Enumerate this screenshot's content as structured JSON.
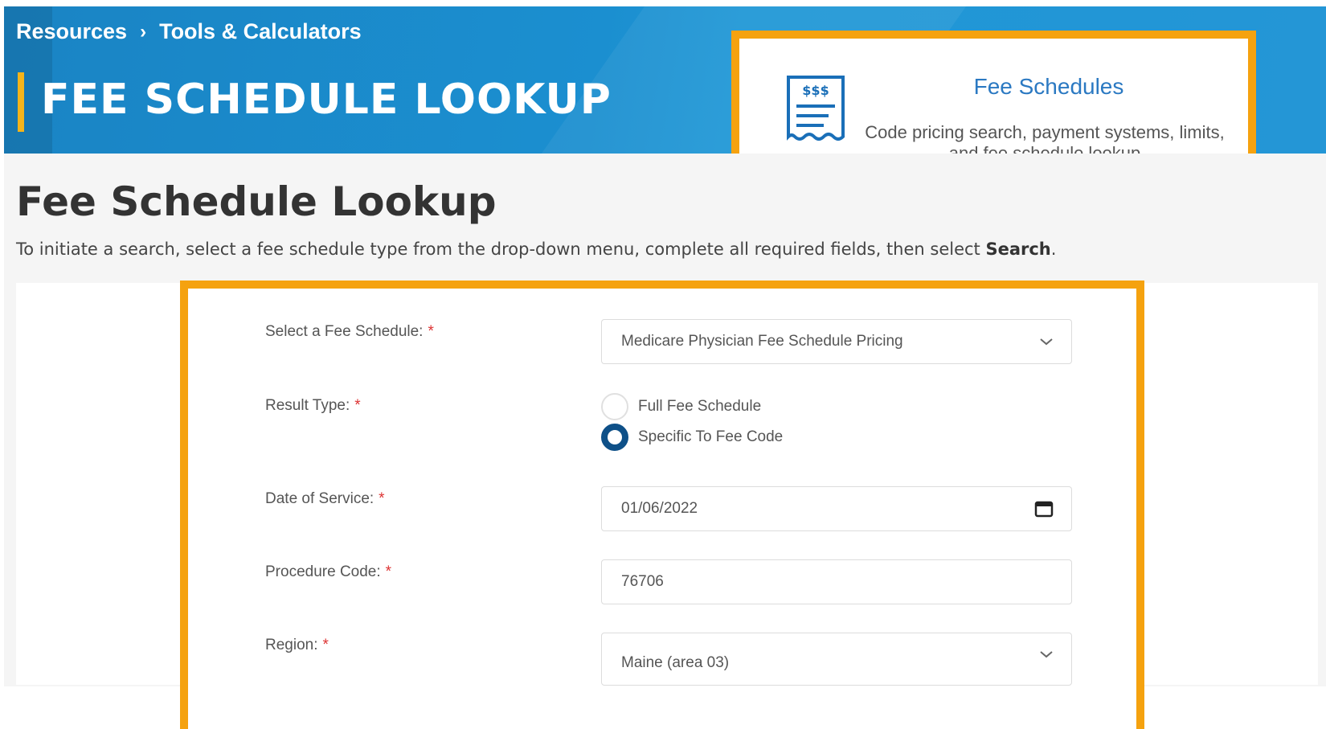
{
  "breadcrumb": {
    "items": [
      "Resources",
      "Tools & Calculators"
    ],
    "separator": "›"
  },
  "banner": {
    "title": "FEE SCHEDULE LOOKUP"
  },
  "card": {
    "title": "Fee Schedules",
    "description": "Code pricing search, payment systems, limits, and fee schedule lookup",
    "icon": "receipt-dollar-icon",
    "icon_text": "$$$"
  },
  "page": {
    "title": "Fee Schedule Lookup",
    "intro_text": "To initiate a search, select a fee schedule type from the drop-down menu, complete all required fields, then select ",
    "intro_bold": "Search",
    "intro_end": "."
  },
  "form": {
    "required_marker": "*",
    "fee_schedule": {
      "label": "Select a Fee Schedule:",
      "value": "Medicare Physician Fee Schedule Pricing"
    },
    "result_type": {
      "label": "Result Type:",
      "options": [
        "Full Fee Schedule",
        "Specific To Fee Code"
      ],
      "selected": "Specific To Fee Code"
    },
    "date_of_service": {
      "label": "Date of Service:",
      "value": "01/06/2022"
    },
    "procedure_code": {
      "label": "Procedure Code:",
      "value": "76706"
    },
    "region": {
      "label": "Region:",
      "value": "Maine (area 03)"
    }
  },
  "colors": {
    "banner": "#1b8fd0",
    "highlight": "#f5a20f",
    "accent_bar": "#f4b41a",
    "radio_selected": "#0e5088",
    "link": "#2b79c2"
  }
}
